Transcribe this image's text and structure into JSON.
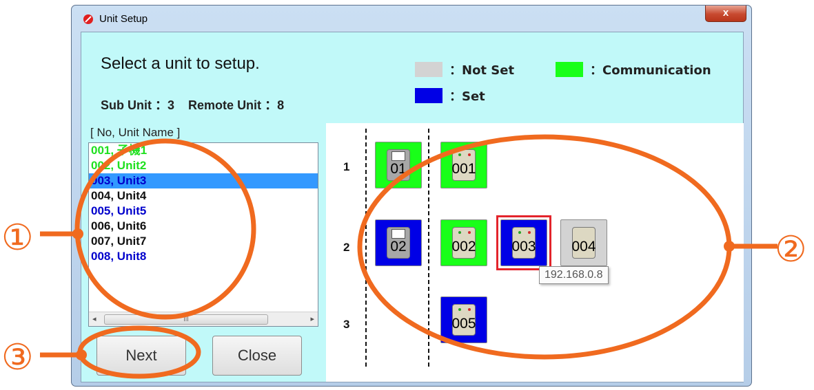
{
  "window": {
    "title": "Unit Setup",
    "close_symbol": "x"
  },
  "header": {
    "prompt": "Select a unit to setup.",
    "sub_unit_label": "Sub Unit",
    "sub_unit_value": "3",
    "remote_unit_label": "Remote Unit",
    "remote_unit_value": "8",
    "separator": "："
  },
  "legend": [
    {
      "color": "#d3d3d3",
      "label": "Not Set"
    },
    {
      "color": "#19ff19",
      "label": "Communication"
    },
    {
      "color": "#0000e6",
      "label": "Set"
    }
  ],
  "list": {
    "header": "[ No, Unit Name ]",
    "items": [
      {
        "text": "001, 子機1",
        "color": "#1ee01e",
        "selected": false
      },
      {
        "text": "002, Unit2",
        "color": "#1ee01e",
        "selected": false
      },
      {
        "text": "003, Unit3",
        "color": "#0000cc",
        "selected": true
      },
      {
        "text": "004, Unit4",
        "color": "#111111",
        "selected": false
      },
      {
        "text": "005, Unit5",
        "color": "#0000cc",
        "selected": false
      },
      {
        "text": "006, Unit6",
        "color": "#111111",
        "selected": false
      },
      {
        "text": "007, Unit7",
        "color": "#111111",
        "selected": false
      },
      {
        "text": "008, Unit8",
        "color": "#0000cc",
        "selected": false
      }
    ],
    "scroll_left": "◂",
    "scroll_right": "▸",
    "scroll_grip": "III"
  },
  "buttons": {
    "next": "Next",
    "close": "Close"
  },
  "map": {
    "row_labels": [
      "1",
      "2",
      "3"
    ],
    "sub_units": [
      {
        "label": "01",
        "status_color": "#19ff19"
      },
      {
        "label": "02",
        "status_color": "#0000e6"
      }
    ],
    "remote_units": [
      {
        "label": "001",
        "status_color": "#19ff19"
      },
      {
        "label": "002",
        "status_color": "#19ff19"
      },
      {
        "label": "003",
        "status_color": "#0000e6",
        "selected": true
      },
      {
        "label": "004",
        "status_color": "#d3d3d3"
      },
      {
        "label": "005",
        "status_color": "#0000e6"
      }
    ],
    "tooltip": "192.168.0.8"
  },
  "annotations": [
    {
      "number": "①"
    },
    {
      "number": "②"
    },
    {
      "number": "③"
    }
  ],
  "colors": {
    "client_bg": "#c1f9f9",
    "selection_bg": "#3399ff",
    "annotation": "#f06a1f"
  }
}
